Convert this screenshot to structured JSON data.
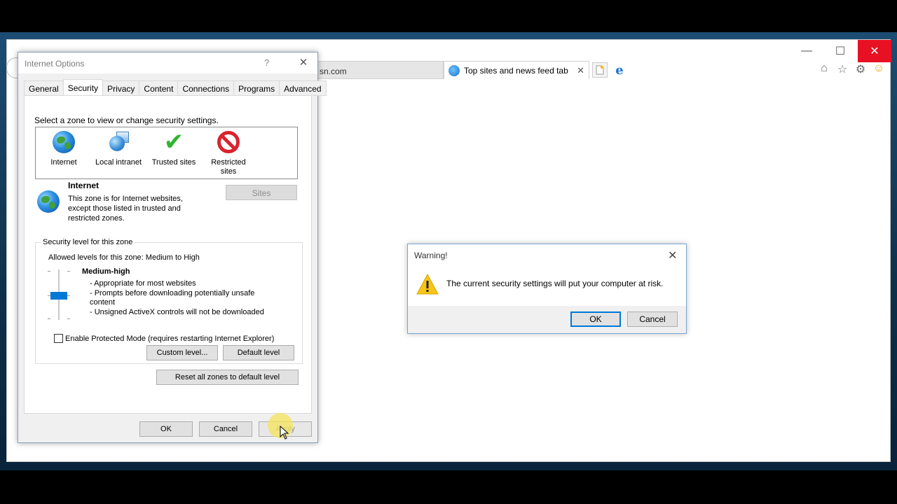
{
  "browser": {
    "inactive_tab": "sn.com",
    "active_tab": "Top sites and news feed tab",
    "tab_close": "✕",
    "window_controls": {
      "minimize": "—",
      "maximize": "☐",
      "close": "✕"
    },
    "toolbar_icons": [
      "home-icon",
      "favorites-star-icon",
      "settings-gear-icon",
      "smiley-feedback-icon"
    ]
  },
  "internet_options": {
    "title": "Internet Options",
    "help": "?",
    "close": "✕",
    "tabs": [
      "General",
      "Security",
      "Privacy",
      "Content",
      "Connections",
      "Programs",
      "Advanced"
    ],
    "selected_tab": "Security",
    "zone_prompt": "Select a zone to view or change security settings.",
    "zones": [
      {
        "label": "Internet",
        "icon": "globe-icon"
      },
      {
        "label": "Local intranet",
        "icon": "local-intranet-icon"
      },
      {
        "label": "Trusted sites",
        "icon": "checkmark-icon"
      },
      {
        "label": "Restricted sites",
        "icon": "no-entry-icon"
      }
    ],
    "zone_info": {
      "title": "Internet",
      "description": "This zone is for Internet websites, except those listed in trusted and restricted zones."
    },
    "sites_button": "Sites",
    "security_level": {
      "legend": "Security level for this zone",
      "allowed": "Allowed levels for this zone: Medium to High",
      "level_name": "Medium-high",
      "lines": [
        "- Appropriate for most websites",
        "- Prompts before downloading potentially unsafe content",
        "- Unsigned ActiveX controls will not be downloaded"
      ],
      "protected_mode_label": "Enable Protected Mode (requires restarting Internet Explorer)",
      "protected_mode_checked": false,
      "custom_button": "Custom level...",
      "default_button": "Default level"
    },
    "reset_button": "Reset all zones to default level",
    "ok": "OK",
    "cancel": "Cancel",
    "apply": "Apply"
  },
  "warning_dialog": {
    "title": "Warning!",
    "close": "✕",
    "message": "The current security settings will put your computer at risk.",
    "ok": "OK",
    "cancel": "Cancel"
  },
  "colors": {
    "accent": "#0078d7",
    "close_red": "#e81123",
    "desktop": "#1c4d73"
  }
}
